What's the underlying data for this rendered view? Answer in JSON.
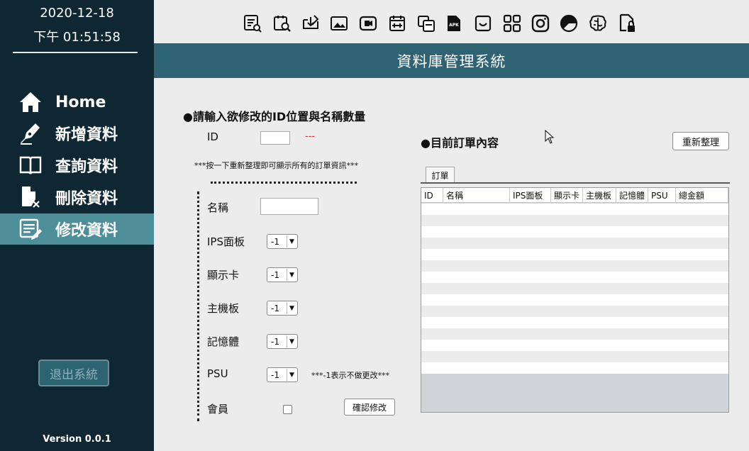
{
  "sidebar": {
    "date": "2020-12-18",
    "time": "下午 01:51:58",
    "nav": [
      {
        "label": "Home",
        "icon": "home-icon"
      },
      {
        "label": "新增資料",
        "icon": "pen-nib-icon"
      },
      {
        "label": "查詢資料",
        "icon": "open-book-icon"
      },
      {
        "label": "刪除資料",
        "icon": "delete-file-icon"
      },
      {
        "label": "修改資料",
        "icon": "edit-list-icon"
      }
    ],
    "active_index": 4,
    "exit_label": "退出系統",
    "version": "Version 0.0.1"
  },
  "toolbar_icons": [
    "list-search-icon",
    "chart-search-icon",
    "edit-download-icon",
    "image-icon",
    "camera-icon",
    "calendar-icon",
    "copy-icon",
    "apk-file-icon",
    "inbox-icon",
    "grid-icon",
    "instagram-icon",
    "pie-chart-icon",
    "brain-icon",
    "file-lock-icon"
  ],
  "header": {
    "title": "資料庫管理系統"
  },
  "form": {
    "section_title": "●請輸入欲修改的ID位置與名稱數量",
    "id_label": "ID",
    "id_status": "---",
    "hint": "***按一下重新整理即可顯示所有的訂單資訊***",
    "name_label": "名稱",
    "fields": [
      {
        "label": "IPS面板",
        "value": "-1"
      },
      {
        "label": "顯示卡",
        "value": "-1"
      },
      {
        "label": "主機板",
        "value": "-1"
      },
      {
        "label": "記憶體",
        "value": "-1"
      },
      {
        "label": "PSU",
        "value": "-1"
      }
    ],
    "psu_note": "***-1表示不做更改***",
    "member_label": "會員",
    "confirm_label": "確認修改"
  },
  "orders": {
    "section_title": "●目前訂單內容",
    "refresh_label": "重新整理",
    "tab_label": "訂單",
    "columns": [
      "ID",
      "名稱",
      "IPS面板",
      "顯示卡",
      "主機板",
      "記憶體",
      "PSU",
      "總金額"
    ]
  },
  "colors": {
    "sidebar": "#0f2633",
    "active": "#4e8e98",
    "header": "#2e6373",
    "status": "#c83232"
  }
}
